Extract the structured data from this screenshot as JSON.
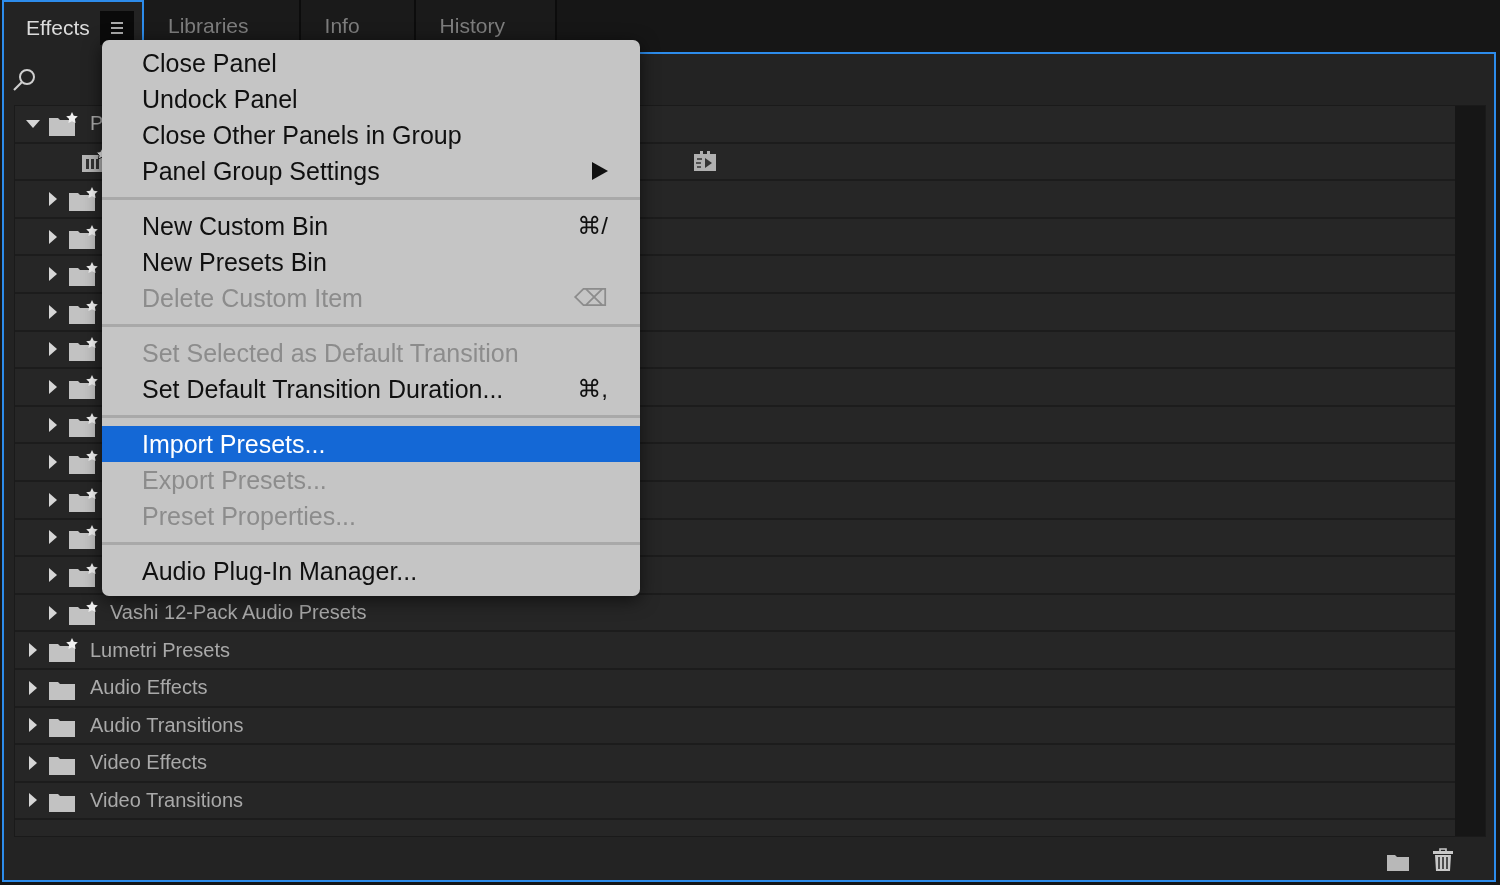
{
  "tabs": [
    {
      "label": "Effects",
      "selected": true,
      "menu_open": true
    },
    {
      "label": "Libraries",
      "selected": false
    },
    {
      "label": "Info",
      "selected": false
    },
    {
      "label": "History",
      "selected": false
    }
  ],
  "tree": [
    {
      "kind": "preset_bin",
      "label": "P",
      "expanded": true,
      "children": [
        {
          "kind": "preset"
        },
        {
          "kind": "preset_bin",
          "expanded": false
        },
        {
          "kind": "preset_bin",
          "expanded": false
        },
        {
          "kind": "preset_bin",
          "expanded": false
        },
        {
          "kind": "preset_bin",
          "expanded": false
        },
        {
          "kind": "preset_bin",
          "expanded": false
        },
        {
          "kind": "preset_bin",
          "expanded": false
        },
        {
          "kind": "preset_bin",
          "expanded": false
        },
        {
          "kind": "preset_bin",
          "expanded": false
        },
        {
          "kind": "preset_bin",
          "expanded": false
        },
        {
          "kind": "preset_bin",
          "expanded": false
        },
        {
          "kind": "preset_bin",
          "expanded": false
        },
        {
          "kind": "preset_bin",
          "label": "Vashi 12-Pack Audio Presets",
          "expanded": false
        }
      ]
    },
    {
      "kind": "preset_bin",
      "label": "Lumetri Presets",
      "expanded": false
    },
    {
      "kind": "folder",
      "label": "Audio Effects",
      "expanded": false
    },
    {
      "kind": "folder",
      "label": "Audio Transitions",
      "expanded": false
    },
    {
      "kind": "folder",
      "label": "Video Effects",
      "expanded": false
    },
    {
      "kind": "folder",
      "label": "Video Transitions",
      "expanded": false
    }
  ],
  "menu": {
    "sections": [
      [
        {
          "label": "Close Panel",
          "disabled": false,
          "selected": false
        },
        {
          "label": "Undock Panel",
          "disabled": false,
          "selected": false
        },
        {
          "label": "Close Other Panels in Group",
          "disabled": false,
          "selected": false
        },
        {
          "label": "Panel Group Settings",
          "disabled": false,
          "selected": false,
          "submenu": true
        }
      ],
      [
        {
          "label": "New Custom Bin",
          "shortcut": "⌘/",
          "disabled": false,
          "selected": false
        },
        {
          "label": "New Presets Bin",
          "disabled": false,
          "selected": false
        },
        {
          "label": "Delete Custom Item",
          "shortcut": "⌫",
          "disabled": true,
          "selected": false
        }
      ],
      [
        {
          "label": "Set Selected as Default Transition",
          "disabled": true,
          "selected": false
        },
        {
          "label": "Set Default Transition Duration...",
          "shortcut": "⌘,",
          "disabled": false,
          "selected": false
        }
      ],
      [
        {
          "label": "Import Presets...",
          "disabled": false,
          "selected": true
        },
        {
          "label": "Export Presets...",
          "disabled": true,
          "selected": false
        },
        {
          "label": "Preset Properties...",
          "disabled": true,
          "selected": false
        }
      ],
      [
        {
          "label": "Audio Plug-In Manager...",
          "disabled": false,
          "selected": false
        }
      ]
    ]
  }
}
